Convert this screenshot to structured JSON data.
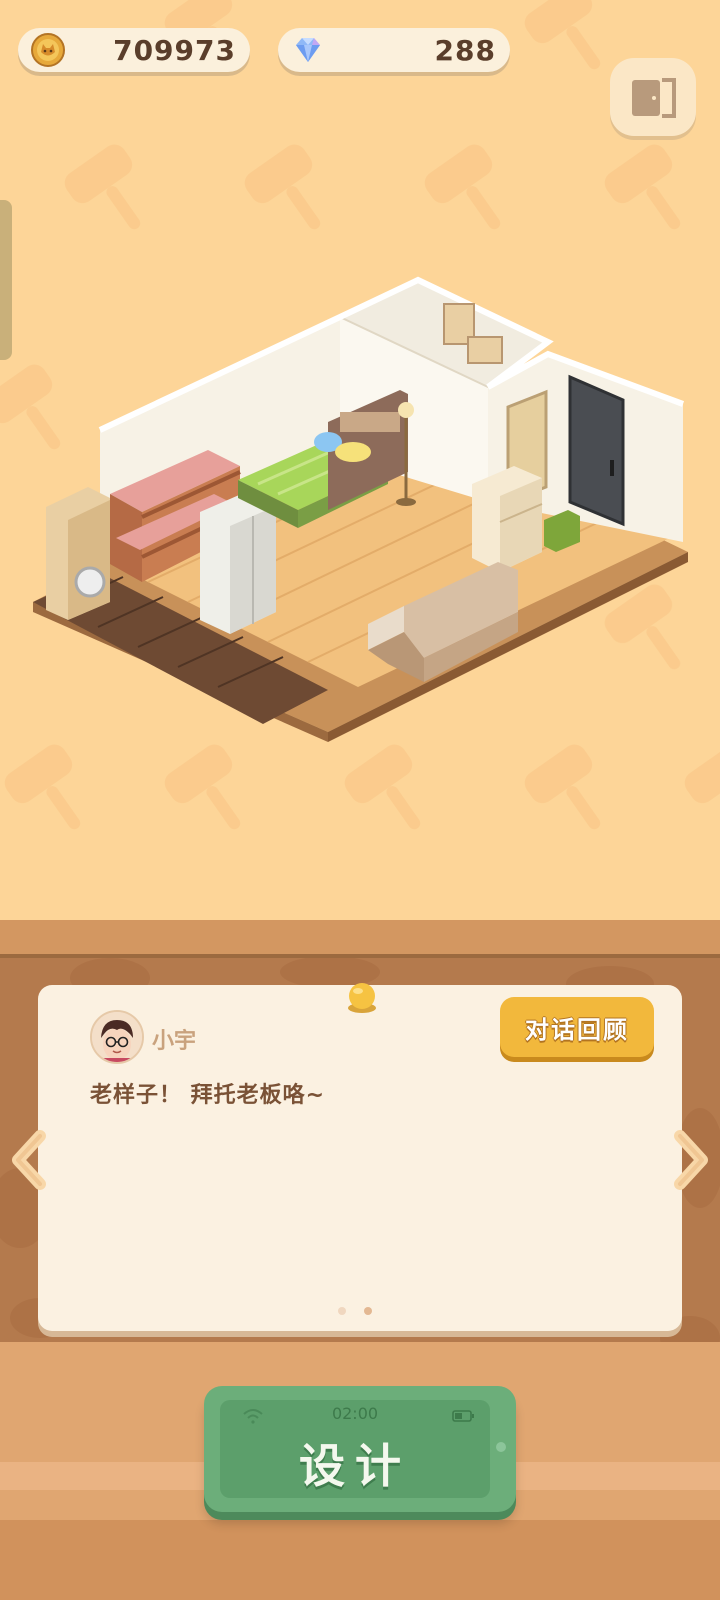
{
  "hud": {
    "coins": "709973",
    "gems": "288",
    "coin_icon": "cat-coin-icon",
    "gem_icon": "diamond-icon",
    "exit_icon": "exit-door-icon"
  },
  "dialog": {
    "speaker": "小宇",
    "text": "老样子！ 拜托老板咯~",
    "history_button": "对话回顾",
    "page_count": 2,
    "current_page": 2
  },
  "design_button": {
    "time": "02:00",
    "label": "设计"
  },
  "colors": {
    "background": "#fdd598",
    "wood_panel": "#b47a4d",
    "card": "#fbf1e1",
    "accent_gold": "#f2b83c",
    "design_green": "#6cae7a"
  }
}
